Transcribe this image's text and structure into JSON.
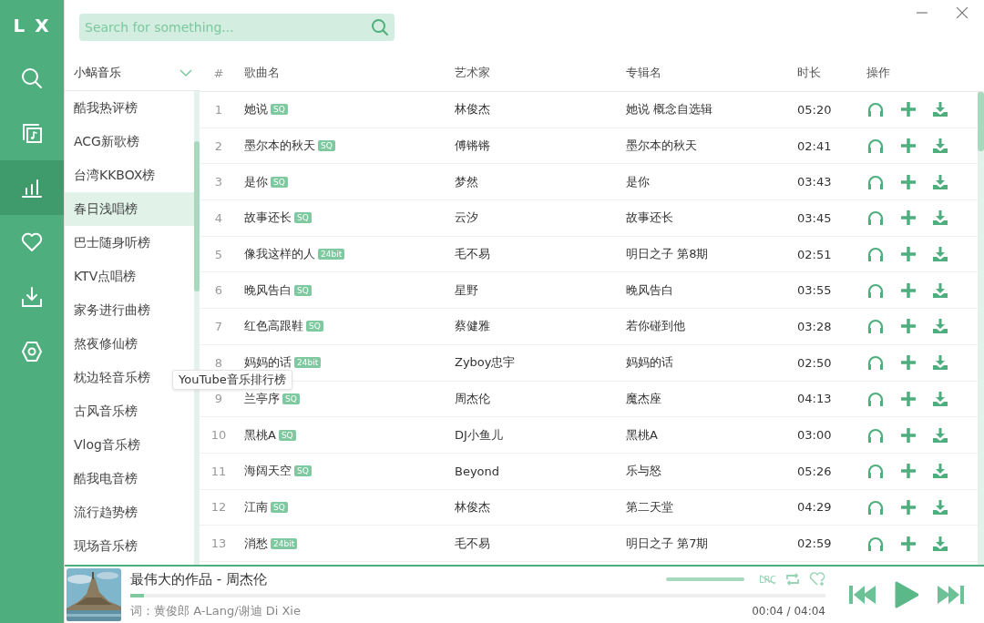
{
  "logo": "L X",
  "nav": [
    {
      "kind": "search",
      "selected": false
    },
    {
      "kind": "library",
      "selected": false
    },
    {
      "kind": "chart",
      "selected": true
    },
    {
      "kind": "heart",
      "selected": false
    },
    {
      "kind": "download",
      "selected": false
    },
    {
      "kind": "settings",
      "selected": false
    }
  ],
  "search": {
    "placeholder": "Search for something..."
  },
  "source_select": {
    "value": "小蜗音乐"
  },
  "chart_list": [
    {
      "label": "酷我热评榜",
      "selected": false
    },
    {
      "label": "ACG新歌榜",
      "selected": false
    },
    {
      "label": "台湾KKBOX榜",
      "selected": false
    },
    {
      "label": "春日浅唱榜",
      "selected": true
    },
    {
      "label": "巴士随身听榜",
      "selected": false
    },
    {
      "label": "KTV点唱榜",
      "selected": false
    },
    {
      "label": "家务进行曲榜",
      "selected": false
    },
    {
      "label": "熬夜修仙榜",
      "selected": false
    },
    {
      "label": "枕边轻音乐榜",
      "selected": false
    },
    {
      "label": "古风音乐榜",
      "selected": false
    },
    {
      "label": "Vlog音乐榜",
      "selected": false
    },
    {
      "label": "酷我电音榜",
      "selected": false
    },
    {
      "label": "流行趋势榜",
      "selected": false
    },
    {
      "label": "现场音乐榜",
      "selected": false
    }
  ],
  "tooltip": "YouTube音乐排行榜",
  "table": {
    "columns": [
      "#",
      "歌曲名",
      "艺术家",
      "专辑名",
      "时长",
      "操作"
    ],
    "rows": [
      {
        "index": "1",
        "title": "她说",
        "quality": "SQ",
        "artist": "林俊杰",
        "album": "她说 概念自选辑",
        "duration": "05:20"
      },
      {
        "index": "2",
        "title": "墨尔本的秋天",
        "quality": "SQ",
        "artist": "傅锵锵",
        "album": "墨尔本的秋天",
        "duration": "02:41"
      },
      {
        "index": "3",
        "title": "是你",
        "quality": "SQ",
        "artist": "梦然",
        "album": "是你",
        "duration": "03:43"
      },
      {
        "index": "4",
        "title": "故事还长",
        "quality": "SQ",
        "artist": "云汐",
        "album": "故事还长",
        "duration": "03:45"
      },
      {
        "index": "5",
        "title": "像我这样的人",
        "quality": "24bit",
        "artist": "毛不易",
        "album": "明日之子 第8期",
        "duration": "02:51"
      },
      {
        "index": "6",
        "title": "晚风告白",
        "quality": "SQ",
        "artist": "星野",
        "album": "晚风告白",
        "duration": "03:55"
      },
      {
        "index": "7",
        "title": "红色高跟鞋",
        "quality": "SQ",
        "artist": "蔡健雅",
        "album": "若你碰到他",
        "duration": "03:28"
      },
      {
        "index": "8",
        "title": "妈妈的话",
        "quality": "24bit",
        "artist": "Zyboy忠宇",
        "album": "妈妈的话",
        "duration": "02:50"
      },
      {
        "index": "9",
        "title": "兰亭序",
        "quality": "SQ",
        "artist": "周杰伦",
        "album": "魔杰座",
        "duration": "04:13"
      },
      {
        "index": "10",
        "title": "黑桃A",
        "quality": "SQ",
        "artist": "DJ小鱼儿",
        "album": "黑桃A",
        "duration": "03:00"
      },
      {
        "index": "11",
        "title": "海阔天空",
        "quality": "SQ",
        "artist": "Beyond",
        "album": "乐与怒",
        "duration": "05:26"
      },
      {
        "index": "12",
        "title": "江南",
        "quality": "SQ",
        "artist": "林俊杰",
        "album": "第二天堂",
        "duration": "04:29"
      },
      {
        "index": "13",
        "title": "消愁",
        "quality": "24bit",
        "artist": "毛不易",
        "album": "明日之子 第7期",
        "duration": "02:59"
      }
    ]
  },
  "player": {
    "title": "最伟大的作品 - 周杰伦",
    "lyric": "词：黄俊郎 A-Lang/谢迪 Di Xie",
    "progress": {
      "level": 0.02
    },
    "volume": {
      "level": 1
    },
    "lrc_button": {
      "label": "LRC",
      "on": false
    },
    "time": "00:04 / 04:04"
  }
}
